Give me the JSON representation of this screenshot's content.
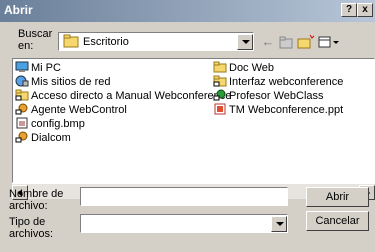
{
  "window": {
    "title": "Abrir",
    "help_label": "?",
    "close_label": "x"
  },
  "lookin": {
    "label": "Buscar en:",
    "value": "Escritorio"
  },
  "files_col1": [
    {
      "name": "Mi PC",
      "icon": "computer-icon"
    },
    {
      "name": "Mis sitios de red",
      "icon": "network-icon"
    },
    {
      "name": "Acceso directo a Manual Webconference",
      "icon": "folder-shortcut-icon"
    },
    {
      "name": "Agente WebControl",
      "icon": "shortcut-icon"
    },
    {
      "name": "config.bmp",
      "icon": "bitmap-icon"
    },
    {
      "name": "Dialcom",
      "icon": "shortcut-icon"
    }
  ],
  "files_col2": [
    {
      "name": "Doc Web",
      "icon": "folder-icon"
    },
    {
      "name": "Interfaz webconference",
      "icon": "folder-shortcut-icon"
    },
    {
      "name": "Profesor WebClass",
      "icon": "app-shortcut-icon"
    },
    {
      "name": "TM Webconference.ppt",
      "icon": "powerpoint-icon"
    }
  ],
  "filename": {
    "label": "Nombre de archivo:",
    "value": ""
  },
  "filetype": {
    "label": "Tipo de archivos:",
    "value": ""
  },
  "buttons": {
    "open": "Abrir",
    "cancel": "Cancelar"
  }
}
